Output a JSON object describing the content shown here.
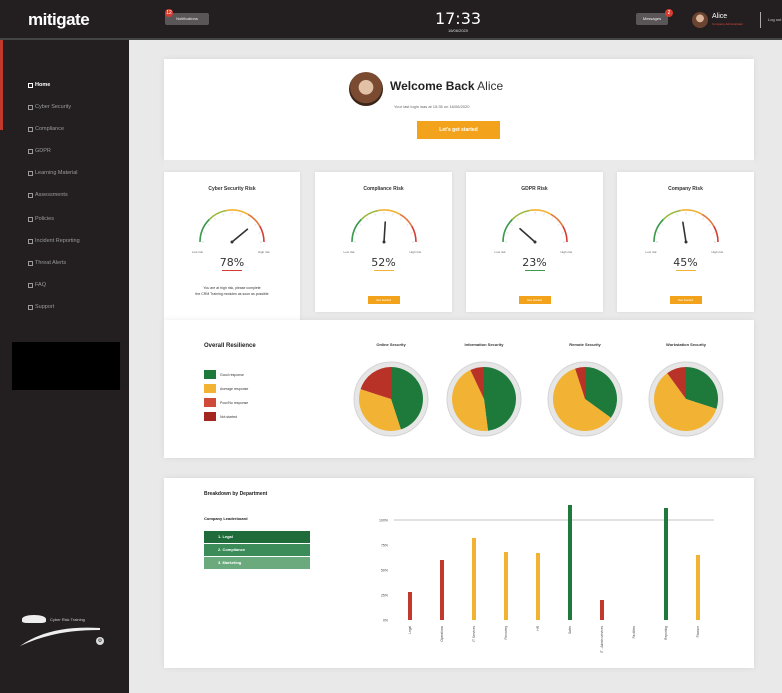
{
  "topbar": {
    "logo": "mitigate",
    "notifications_label": "Notifications",
    "notifications_badge": "12",
    "time": "17:33",
    "date": "16/06/2020",
    "messages_label": "Messages",
    "messages_badge": "2",
    "user_name": "Alice",
    "user_role": "Company Administrator",
    "logout_label": "Log out"
  },
  "sidebar": {
    "items": [
      {
        "label": "Home",
        "active": true
      },
      {
        "label": "Cyber Security",
        "active": false
      },
      {
        "label": "Compliance",
        "active": false
      },
      {
        "label": "GDPR",
        "active": false
      },
      {
        "label": "Learning Material",
        "active": false
      },
      {
        "label": "Assessments",
        "active": false
      },
      {
        "label": "Policies",
        "active": false
      },
      {
        "label": "Incident Reporting",
        "active": false
      },
      {
        "label": "Threat Alerts",
        "active": false
      },
      {
        "label": "FAQ",
        "active": false
      },
      {
        "label": "Support",
        "active": false
      }
    ],
    "footer_text": "Cyber Risk Training"
  },
  "welcome": {
    "greeting": "Welcome Back",
    "name": "Alice",
    "subtitle": "Your last login was at 15:35 on 16/06/2020",
    "button": "Let's get started"
  },
  "gauges": [
    {
      "title": "Cyber Security Risk",
      "value": 78,
      "display": "78%",
      "low": "Low risk",
      "high": "High risk",
      "note_line1": "You are at high risk, please complete",
      "note_line2": "the CRM Training modules as soon as possible",
      "button": ""
    },
    {
      "title": "Compliance Risk",
      "value": 52,
      "display": "52%",
      "low": "Low risk",
      "high": "High risk",
      "button": "Get started"
    },
    {
      "title": "GDPR Risk",
      "value": 23,
      "display": "23%",
      "low": "Low risk",
      "high": "High risk",
      "button": "Get started"
    },
    {
      "title": "Company Risk",
      "value": 45,
      "display": "45%",
      "low": "Low risk",
      "high": "High risk",
      "button": "Get started"
    }
  ],
  "resilience": {
    "title": "Overall Resilience",
    "legend": [
      {
        "label": "Good response",
        "color": "#1e7a3a"
      },
      {
        "label": "Average response",
        "color": "#f2b233"
      },
      {
        "label": "Poor/No response",
        "color": "#d04a3a"
      },
      {
        "label": "Not started",
        "color": "#a3261f"
      }
    ],
    "pies": [
      {
        "title": "Online Security",
        "slices": [
          {
            "label": "Good response",
            "value": 45,
            "color": "#1e7a3a"
          },
          {
            "label": "Average response",
            "value": 35,
            "color": "#f2b233"
          },
          {
            "label": "Poor/No response",
            "value": 20,
            "color": "#b83227"
          }
        ]
      },
      {
        "title": "Information Security",
        "slices": [
          {
            "label": "Good response",
            "value": 48,
            "color": "#1e7a3a"
          },
          {
            "label": "Average response",
            "value": 45,
            "color": "#f2b233"
          },
          {
            "label": "Poor/No response",
            "value": 7,
            "color": "#b83227"
          }
        ]
      },
      {
        "title": "Remote Security",
        "slices": [
          {
            "label": "Good response",
            "value": 35,
            "color": "#1e7a3a"
          },
          {
            "label": "Average response",
            "value": 60,
            "color": "#f2b233"
          },
          {
            "label": "Poor/No response",
            "value": 5,
            "color": "#b83227"
          }
        ]
      },
      {
        "title": "Workstation Security",
        "slices": [
          {
            "label": "Good response",
            "value": 30,
            "color": "#1e7a3a"
          },
          {
            "label": "Average response",
            "value": 60,
            "color": "#f2b233"
          },
          {
            "label": "Poor/No response",
            "value": 10,
            "color": "#b83227"
          }
        ]
      }
    ]
  },
  "breakdown": {
    "title": "Breakdown by Department",
    "leaderboard_title": "Company Leaderboard",
    "leaderboard": [
      {
        "label": "1. Legal",
        "color": "#1f6b3a"
      },
      {
        "label": "2. Compliance",
        "color": "#3b8c58"
      },
      {
        "label": "3. Marketing",
        "color": "#6aaa7d"
      }
    ]
  },
  "chart_data": {
    "type": "bar",
    "yticks": [
      "100%",
      "75%",
      "50%",
      "25%",
      "0%"
    ],
    "ylim": [
      0,
      100
    ],
    "categories": [
      "Legal",
      "Operations",
      "IT Services",
      "Recovery",
      "HR",
      "Sales",
      "IT - Admin services",
      "Facilities",
      "Reporting",
      "Finance"
    ],
    "bars": [
      {
        "category": "Legal",
        "value": 28,
        "color": "#c0392b"
      },
      {
        "category": "Operations",
        "value": 60,
        "color": "#c0392b"
      },
      {
        "category": "IT Services",
        "value": 82,
        "color": "#f2b233"
      },
      {
        "category": "Recovery",
        "value": 68,
        "color": "#f2b233"
      },
      {
        "category": "HR",
        "value": 67,
        "color": "#f2b233"
      },
      {
        "category": "Sales",
        "value": 115,
        "color": "#1e7a3a"
      },
      {
        "category": "IT - Admin services",
        "value": 20,
        "color": "#c0392b"
      },
      {
        "category": "Facilities",
        "value": 0,
        "color": "#f2b233"
      },
      {
        "category": "Reporting",
        "value": 112,
        "color": "#1e7a3a"
      },
      {
        "category": "Finance",
        "value": 65,
        "color": "#f2b233"
      }
    ]
  }
}
